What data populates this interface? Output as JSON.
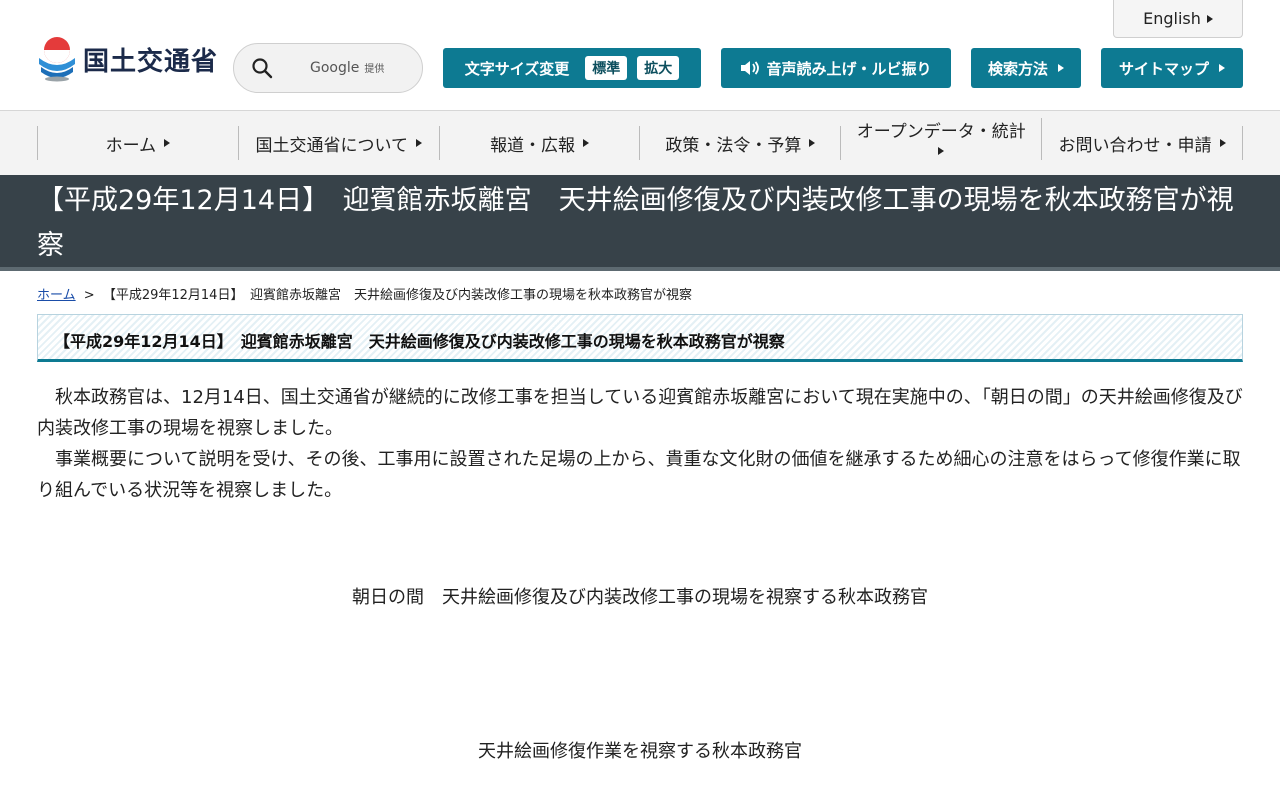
{
  "header": {
    "logo_text": "国土交通省",
    "search": {
      "provider": "Google",
      "provider_note": "提供"
    },
    "english_label": "English",
    "font_size": {
      "label": "文字サイズ変更",
      "standard": "標準",
      "large": "拡大"
    },
    "speech_label": "音声読み上げ・ルビ振り",
    "search_method_label": "検索方法",
    "sitemap_label": "サイトマップ",
    "accent_color": "#0d7a92"
  },
  "nav": {
    "items": [
      {
        "label": "ホーム"
      },
      {
        "label": "国土交通省について"
      },
      {
        "label": "報道・広報"
      },
      {
        "label": "政策・法令・予算"
      },
      {
        "label": "オープンデータ・統計"
      },
      {
        "label": "お問い合わせ・申請"
      }
    ]
  },
  "page": {
    "title": "【平成29年12月14日】　迎賓館赤坂離宮　天井絵画修復及び内装改修工事の現場を秋本政務官が視察",
    "breadcrumb": {
      "home": "ホーム",
      "separator": ">",
      "current": "【平成29年12月14日】　迎賓館赤坂離宮　天井絵画修復及び内装改修工事の現場を秋本政務官が視察"
    },
    "subtitle": "【平成29年12月14日】　迎賓館赤坂離宮　天井絵画修復及び内装改修工事の現場を秋本政務官が視察",
    "paragraphs": [
      "秋本政務官は、12月14日、国土交通省が継続的に改修工事を担当している迎賓館赤坂離宮において現在実施中の、「朝日の間」の天井絵画修復及び内装改修工事の現場を視察しました。",
      "事業概要について説明を受け、その後、工事用に設置された足場の上から、貴重な文化財の価値を継承するため細心の注意をはらって修復作業に取り組んでいる状況等を視察しました。"
    ],
    "captions": [
      "朝日の間　天井絵画修復及び内装改修工事の現場を視察する秋本政務官",
      "天井絵画修復作業を視察する秋本政務官"
    ]
  }
}
